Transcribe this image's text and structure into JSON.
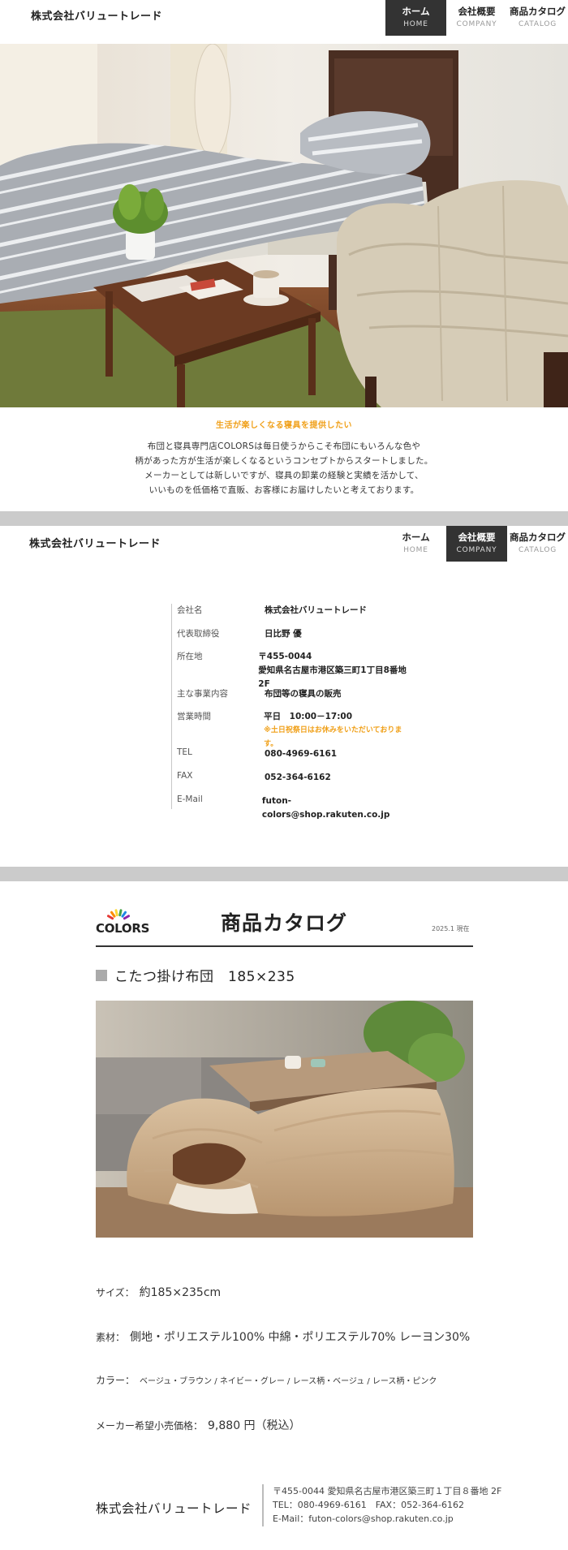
{
  "header": {
    "logo": "株式会社バリュートレード",
    "nav": [
      {
        "jp": "ホーム",
        "en": "HOME"
      },
      {
        "jp": "会社概要",
        "en": "COMPANY"
      },
      {
        "jp": "商品カタログ",
        "en": "CATALOG"
      }
    ]
  },
  "intro": {
    "tagline": "生活が楽しくなる寝具を提供したい",
    "lines": [
      "布団と寝具専門店COLORSは毎日使うからこそ布団にもいろんな色や",
      "柄があった方が生活が楽しくなるというコンセプトからスタートしました。",
      "メーカーとしては新しいですが、寝具の卸業の経験と実績を活かして、",
      "いいものを低価格で直販、お客様にお届けしたいと考えております。"
    ]
  },
  "company": {
    "rows": [
      {
        "k": "会社名",
        "v": "株式会社バリュートレード"
      },
      {
        "k": "代表取締役",
        "v": "日比野 優"
      },
      {
        "k": "所在地",
        "v": "〒455-0044",
        "v2": "愛知県名古屋市港区築三町1丁目8番地　2F"
      },
      {
        "k": "主な事業内容",
        "v": "布団等の寝具の販売"
      },
      {
        "k": "営業時間",
        "v": "平日　10:00－17:00",
        "note": "※土日祝祭日はお休みをいただいております。"
      },
      {
        "k": "TEL",
        "v": "080-4969-6161"
      },
      {
        "k": "FAX",
        "v": "052-364-6162"
      },
      {
        "k": "E-Mail",
        "v": "futon-colors@shop.rakuten.co.jp"
      }
    ]
  },
  "catalog": {
    "brand": "COLORS",
    "title": "商品カタログ",
    "date": "2025.1 現在",
    "product_name": "こたつ掛け布団　185×235",
    "size_label": "サイズ：",
    "size_value": "約185×235cm",
    "material_label": "素材：",
    "material_value": "側地・ポリエステル100% 中綿・ポリエステル70% レーヨン30%",
    "color_label": "カラー：",
    "color_value": "ベージュ・ブラウン / ネイビー・グレー / レース柄・ベージュ / レース柄・ピンク",
    "price_label": "メーカー希望小売価格：",
    "price_value": "9,880 円（税込）"
  },
  "footer": {
    "company": "株式会社バリュートレード",
    "address": "〒455-0044 愛知県名古屋市港区築三町１丁目８番地  2F",
    "tel_fax": "TEL：080-4969-6161　FAX：052-364-6162",
    "email": "E-Mail：futon-colors@shop.rakuten.co.jp"
  },
  "colors": {
    "accent": "#f0a019",
    "nav_active": "#333333",
    "band": "#cbcbcb"
  }
}
